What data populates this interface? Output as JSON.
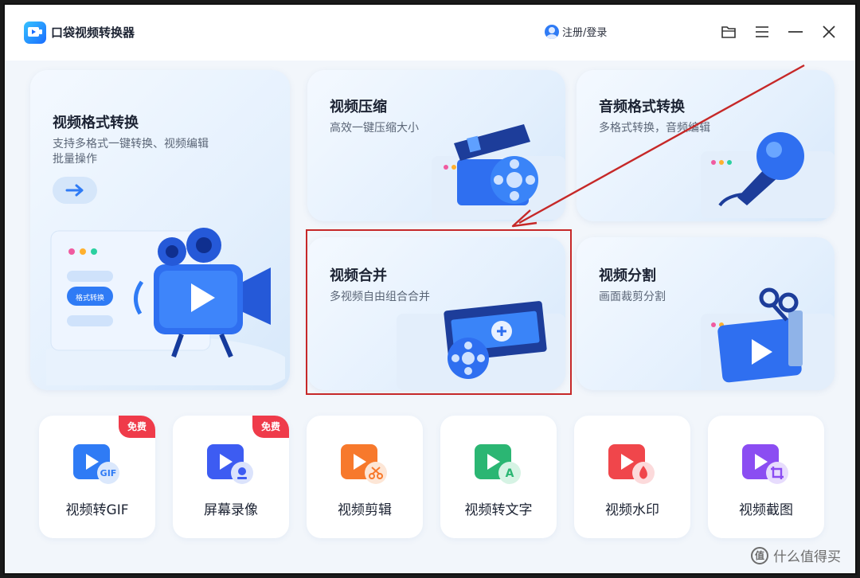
{
  "app": {
    "title": "口袋视频转换器",
    "login_label": "注册/登录"
  },
  "window_controls": [
    {
      "icon": "folder-icon"
    },
    {
      "icon": "menu-icon"
    },
    {
      "icon": "minimize-icon"
    },
    {
      "icon": "close-icon"
    }
  ],
  "main_card": {
    "title": "视频格式转换",
    "subtitle_line1": "支持多格式一键转换、视频编辑",
    "subtitle_line2": "批量操作",
    "pill_label": "格式转换"
  },
  "cards": [
    {
      "id": "compress",
      "title": "视频压缩",
      "subtitle": "高效一键压缩大小"
    },
    {
      "id": "audio",
      "title": "音频格式转换",
      "subtitle": "多格式转换，音频编辑"
    },
    {
      "id": "merge",
      "title": "视频合并",
      "subtitle": "多视频自由组合合并"
    },
    {
      "id": "split",
      "title": "视频分割",
      "subtitle": "画面裁剪分割"
    }
  ],
  "tools": [
    {
      "label": "视频转GIF",
      "badge": "免费",
      "color": "#2f7bf5",
      "mini": "GIF"
    },
    {
      "label": "屏幕录像",
      "badge": "免费",
      "color": "#3d5cf2",
      "mini": ""
    },
    {
      "label": "视频剪辑",
      "badge": "",
      "color": "#f7792c",
      "mini": ""
    },
    {
      "label": "视频转文字",
      "badge": "",
      "color": "#2bb673",
      "mini": "A"
    },
    {
      "label": "视频水印",
      "badge": "",
      "color": "#f0464b",
      "mini": ""
    },
    {
      "label": "视频截图",
      "badge": "",
      "color": "#8b4df2",
      "mini": ""
    }
  ],
  "watermark": {
    "text": "什么值得买",
    "mark": "值"
  },
  "colors": {
    "accent": "#2f7bf5",
    "highlight": "#c62828",
    "badge": "#ef3b4a"
  }
}
